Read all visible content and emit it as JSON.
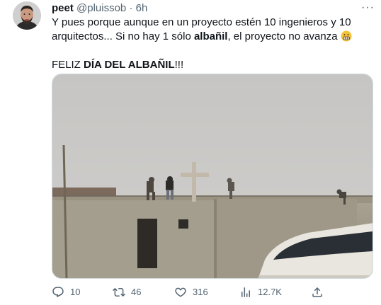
{
  "tweet": {
    "name": "peet",
    "handle": "@pluissob",
    "separator": "·",
    "time": "6h",
    "more_glyph": "···",
    "text_line1_a": "Y pues porque aunque en un proyecto estén 10 ingenieros y 10 arquitectos... Si no hay 1 sólo ",
    "text_line1_bold": "albañil",
    "text_line1_b": ", el proyecto no avanza",
    "text_line2_a": "FELIZ ",
    "text_line2_bold": "DÍA DEL ALBAÑIL",
    "text_line2_b": "!!!"
  },
  "actions": {
    "replies": "10",
    "retweets": "46",
    "likes": "316",
    "views": "12.7K"
  },
  "icons": {
    "reply": "reply-icon",
    "retweet": "retweet-icon",
    "like": "heart-icon",
    "views": "views-icon",
    "share": "share-icon",
    "emoji": "grimacing-face-emoji"
  },
  "colors": {
    "text": "#0f1419",
    "secondary": "#536471",
    "sky": "#c9c8c6",
    "concrete": "#a39d8e"
  }
}
